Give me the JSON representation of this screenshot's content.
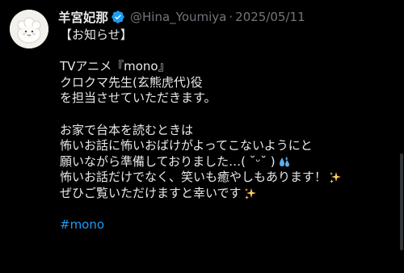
{
  "tweet": {
    "display_name": "羊宮妃那",
    "handle": "@Hina_Youmiya",
    "separator": "·",
    "date": "2025/05/11",
    "lines": [
      "【お知らせ】",
      "",
      "TVアニメ『mono』",
      "クロクマ先生(玄熊虎代)役",
      "を担当させていただきます。",
      "",
      "お家で台本を読むときは",
      "怖いお話に怖いおばけがよってこないようにと",
      "願いながら準備しておりました…( ˘ᵕ˘ )",
      "怖いお話だけでなく、笑いも癒やしもあります！",
      "ぜひご覧いただけますと幸いです"
    ],
    "hashtag": "#mono",
    "emojis": {
      "line8": "sweat-droplets-icon",
      "line9": "sparkles-icon",
      "line10": "sparkles-icon"
    }
  },
  "colors": {
    "background": "#000000",
    "text": "#e7e9ea",
    "muted": "#71767b",
    "accent": "#1d9bf0",
    "verified": "#1d9bf0"
  }
}
